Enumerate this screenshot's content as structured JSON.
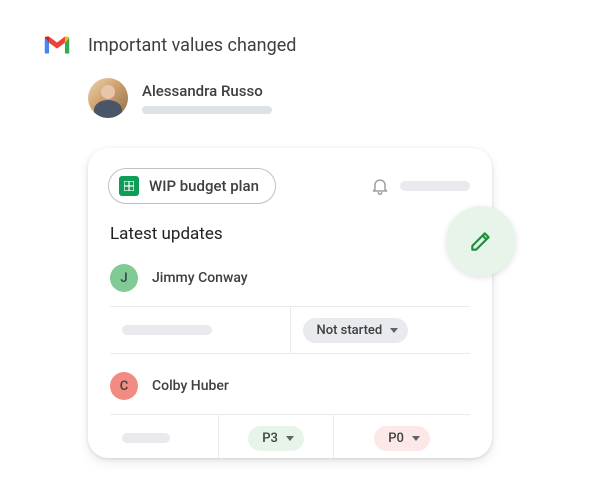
{
  "header": {
    "title": "Important values changed"
  },
  "sender": {
    "name": "Alessandra Russo"
  },
  "card": {
    "chip_label": "WIP budget plan",
    "section_title": "Latest updates",
    "users": [
      {
        "initial": "J",
        "name": "Jimmy Conway",
        "avatar_class": "avatar-green"
      },
      {
        "initial": "C",
        "name": "Colby Huber",
        "avatar_class": "avatar-red"
      }
    ],
    "row1": {
      "status": "Not started"
    },
    "row2": {
      "priority_a": "P3",
      "priority_b": "P0"
    }
  }
}
